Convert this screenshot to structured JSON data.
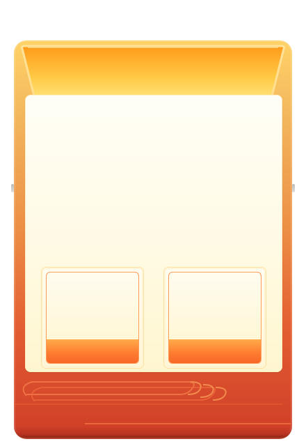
{
  "theme": {
    "accent": "#ff8b39",
    "header_top": "#ff9f1c",
    "header_bottom": "#ffe780",
    "panel": "#fffbe8",
    "frame_top": "#ffd267",
    "frame_bottom": "#cf3d27",
    "slot_fill": "#ff7e32"
  },
  "header": {
    "title": ""
  },
  "slots": [
    {
      "label": "",
      "fill_fraction": 0.26
    },
    {
      "label": "",
      "fill_fraction": 0.26
    }
  ],
  "decor": {
    "side_nub_icon": "slider-handle-icon",
    "swoosh_icon": "cloud-swoosh-icon"
  }
}
